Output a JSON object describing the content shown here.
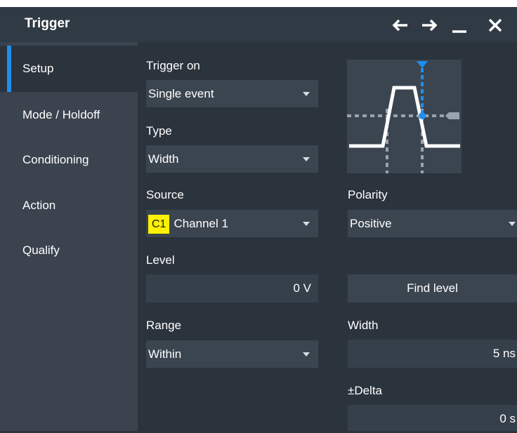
{
  "window": {
    "title": "Trigger",
    "buttons": [
      "back-arrow-icon",
      "forward-arrow-icon",
      "minimize-icon",
      "close-icon"
    ]
  },
  "sidebar": {
    "items": [
      {
        "label": "Setup",
        "active": true
      },
      {
        "label": "Mode / Holdoff",
        "active": false
      },
      {
        "label": "Conditioning",
        "active": false
      },
      {
        "label": "Action",
        "active": false
      },
      {
        "label": "Qualify",
        "active": false
      }
    ]
  },
  "setup": {
    "trigger_on": {
      "label": "Trigger on",
      "value": "Single event"
    },
    "type": {
      "label": "Type",
      "value": "Width"
    },
    "source": {
      "label": "Source",
      "badge": "C1",
      "value": "Channel 1",
      "badge_color": "#fff200"
    },
    "polarity": {
      "label": "Polarity",
      "value": "Positive"
    },
    "level": {
      "label": "Level",
      "value": "0 V"
    },
    "find_level": {
      "label": "Find level"
    },
    "range": {
      "label": "Range",
      "value": "Within"
    },
    "width": {
      "label": "Width",
      "value": "5 ns"
    },
    "delta": {
      "label": "±Delta",
      "value": "0 s"
    }
  },
  "colors": {
    "accent": "#1e8ff0",
    "background": "#2b333d",
    "sidebar": "#3a434e"
  }
}
